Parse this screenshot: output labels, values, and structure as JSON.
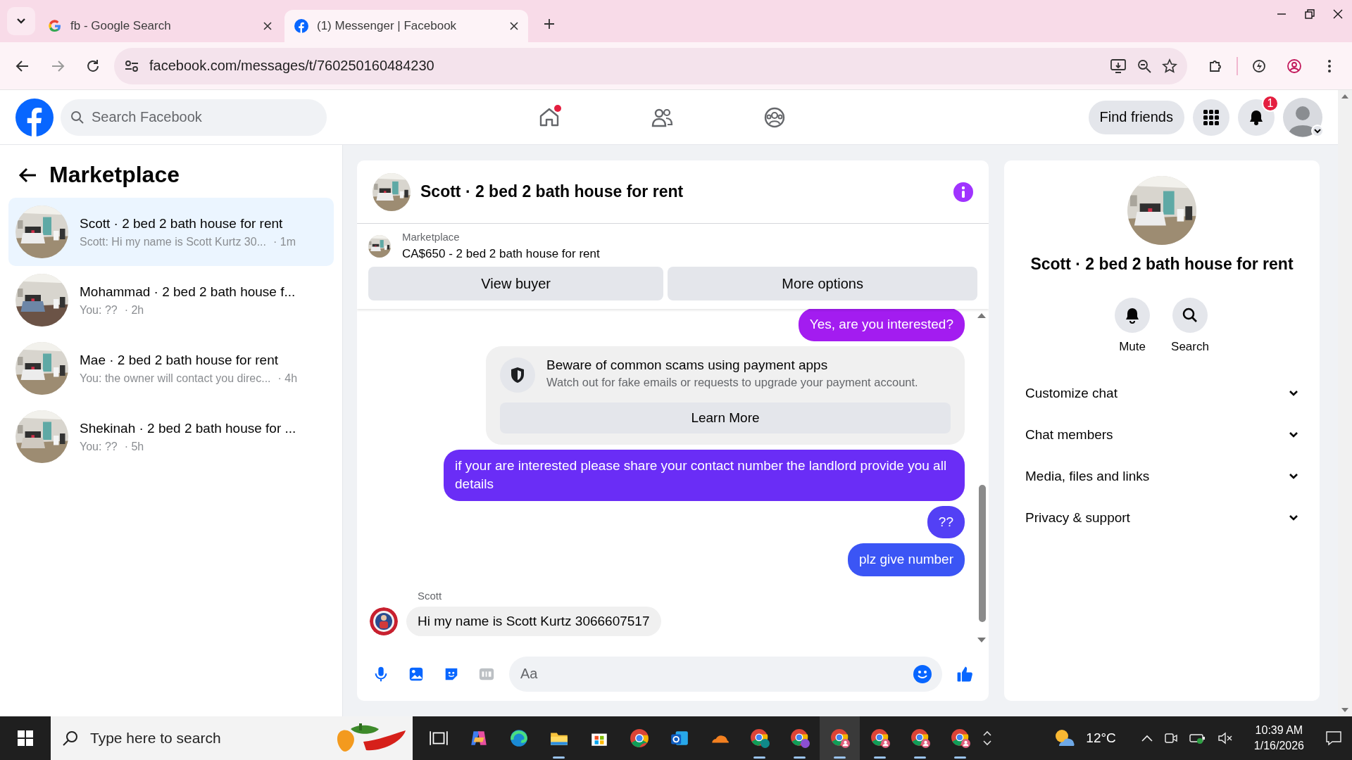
{
  "browser": {
    "tabs": [
      {
        "title": "fb - Google Search",
        "kind": "google",
        "selected": false
      },
      {
        "title": "(1) Messenger | Facebook",
        "kind": "facebook",
        "selected": true
      }
    ],
    "url": "facebook.com/messages/t/760250160484230",
    "forward_disabled": true
  },
  "header": {
    "search": {
      "placeholder": "Search Facebook"
    },
    "nav": [
      {
        "kind": "home",
        "dot": true
      },
      {
        "kind": "friends",
        "dot": false
      },
      {
        "kind": "groups",
        "dot": false
      }
    ],
    "find_friends": "Find friends",
    "notifications_badge": "1"
  },
  "sidebar": {
    "title": "Marketplace",
    "conversations": [
      {
        "title": "Scott · 2 bed 2 bath house for rent",
        "preview": "Scott: Hi my name is Scott Kurtz 30...",
        "time": "· 1m",
        "selected": true
      },
      {
        "title": "Mohammad · 2 bed 2 bath house f...",
        "preview": "You: ??",
        "time": "· 2h",
        "selected": false
      },
      {
        "title": "Mae · 2 bed 2 bath house for rent",
        "preview": "You: the owner will contact you direc...",
        "time": "· 4h",
        "selected": false
      },
      {
        "title": "Shekinah · 2 bed 2 bath house for ...",
        "preview": "You: ??",
        "time": "· 5h",
        "selected": false
      }
    ]
  },
  "chat": {
    "title": "Scott · 2 bed 2 bath house for rent",
    "listing": {
      "label": "Marketplace",
      "text": "CA$650 - 2 bed 2 bath house for rent"
    },
    "actions": [
      "View buyer",
      "More options"
    ],
    "messages": [
      {
        "kind": "outgoing",
        "text": "Yes, are you interested?",
        "color": "#a31cf0"
      },
      {
        "kind": "notice",
        "title": "Beware of common scams using payment apps",
        "text": "Watch out for fake emails or requests to upgrade your payment account.",
        "button": "Learn More"
      },
      {
        "kind": "outgoing",
        "text": "if your are interested please share your contact number the landlord provide you all details",
        "color": "#6a2df6"
      },
      {
        "kind": "outgoing",
        "text": "??",
        "color": "#5340f5"
      },
      {
        "kind": "outgoing",
        "text": "plz give number",
        "color": "#3b55f5"
      },
      {
        "kind": "incoming",
        "sender": "Scott",
        "text": "Hi my name is Scott Kurtz 3066607517"
      }
    ],
    "composer": {
      "placeholder": "Aa"
    }
  },
  "details": {
    "title": "Scott · 2 bed 2 bath house for rent",
    "actions": [
      {
        "kind": "mute",
        "label": "Mute"
      },
      {
        "kind": "search",
        "label": "Search"
      }
    ],
    "sections": [
      {
        "label": "Customize chat",
        "expanded": false
      },
      {
        "label": "Chat members",
        "expanded": false
      },
      {
        "label": "Media, files and links",
        "expanded": false
      },
      {
        "label": "Privacy & support",
        "expanded": false
      }
    ]
  },
  "taskbar": {
    "search_placeholder": "Type here to search",
    "apps": [
      {
        "kind": "taskview",
        "running": false,
        "selected": false
      },
      {
        "kind": "copilot",
        "running": false,
        "selected": false
      },
      {
        "kind": "edge",
        "running": false,
        "selected": false
      },
      {
        "kind": "explorer",
        "running": true,
        "selected": false
      },
      {
        "kind": "store",
        "running": false,
        "selected": false
      },
      {
        "kind": "chrome",
        "running": false,
        "selected": false
      },
      {
        "kind": "outlook",
        "running": false,
        "selected": false
      },
      {
        "kind": "cloud",
        "running": false,
        "selected": false
      },
      {
        "kind": "chrome-teal",
        "running": true,
        "selected": false
      },
      {
        "kind": "chrome-purple",
        "running": true,
        "selected": false
      },
      {
        "kind": "chrome-profile",
        "running": true,
        "selected": true
      },
      {
        "kind": "chrome-profile",
        "running": true,
        "selected": false
      },
      {
        "kind": "chrome-profile",
        "running": true,
        "selected": false
      },
      {
        "kind": "chrome-profile",
        "running": true,
        "selected": false
      }
    ],
    "weather": "12°C",
    "time": "10:39 AM",
    "date": "1/16/2026"
  }
}
